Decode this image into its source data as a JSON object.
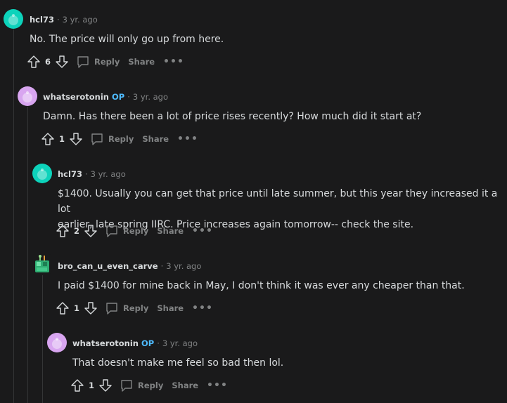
{
  "comments": [
    {
      "author": "hcl73",
      "op_badge": "",
      "time": "3 yr. ago",
      "body": "No. The price will only go up from here.",
      "votes": "6",
      "reply_label": "Reply",
      "share_label": "Share",
      "more_label": "•••"
    },
    {
      "author": "whatserotonin",
      "op_badge": "OP",
      "time": "3 yr. ago",
      "body": "Damn. Has there been a lot of price rises recently? How much did it start at?",
      "votes": "1",
      "reply_label": "Reply",
      "share_label": "Share",
      "more_label": "•••"
    },
    {
      "author": "hcl73",
      "op_badge": "",
      "time": "3 yr. ago",
      "body_line1": "$1400. Usually you can get that price until late summer, but this year they increased it a lot",
      "body_line2": "earlier, late spring IIRC. Price increases again tomorrow-- check the site.",
      "votes": "2",
      "reply_label": "Reply",
      "share_label": "Share",
      "more_label": "•••"
    },
    {
      "author": "bro_can_u_even_carve",
      "op_badge": "",
      "time": "3 yr. ago",
      "body": "I paid $1400 for mine back in May, I don't think it was ever any cheaper than that.",
      "votes": "1",
      "reply_label": "Reply",
      "share_label": "Share",
      "more_label": "•••"
    },
    {
      "author": "whatserotonin",
      "op_badge": "OP",
      "time": "3 yr. ago",
      "body": "That doesn't make me feel so bad then lol.",
      "votes": "1",
      "reply_label": "Reply",
      "share_label": "Share",
      "more_label": "•••"
    }
  ],
  "separator": "·",
  "colors": {
    "background": "#1a1a1b",
    "text": "#d7dadc",
    "muted": "#818384",
    "op_badge": "#4fbcff",
    "thread_line": "#343536",
    "avatar_teal": "#0dd3bb",
    "avatar_pink": "#d8a5f0"
  }
}
